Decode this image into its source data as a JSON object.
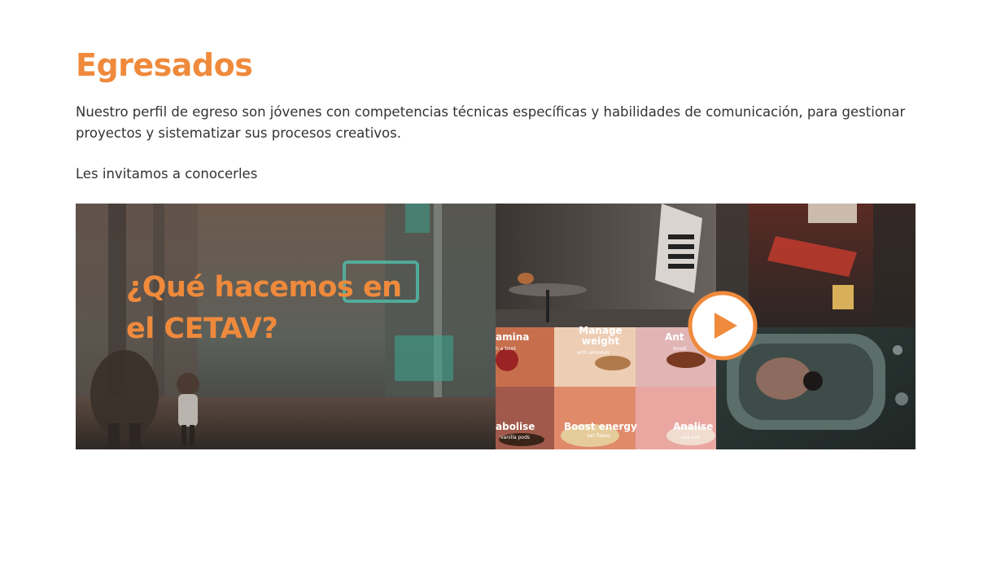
{
  "section": {
    "title": "Egresados",
    "description": "Nuestro perfil de egreso son jóvenes con competencias técnicas específicas y habilidades de comunicación, para gestionar proyectos y sistematizar sus procesos creativos.",
    "invite": "Les invitamos a conocerles"
  },
  "video": {
    "overlay_line1": "¿Qué hacemos en",
    "overlay_line2": "el CETAV?",
    "tiles": {
      "t1": "amina",
      "t1_sub": "n a beet",
      "t2": "Manage weight",
      "t2_sub": "with almonds",
      "t3": "Ant",
      "t3_sub": "boost",
      "t4": "abolise",
      "t4_sub": "vanilla pods",
      "t5": "Boost energy",
      "t5_sub": "oat flakes",
      "t6": "Analise",
      "t6_sub": "sea salt"
    },
    "play_icon": "play-icon",
    "accent_color": "#ef8a3c"
  }
}
